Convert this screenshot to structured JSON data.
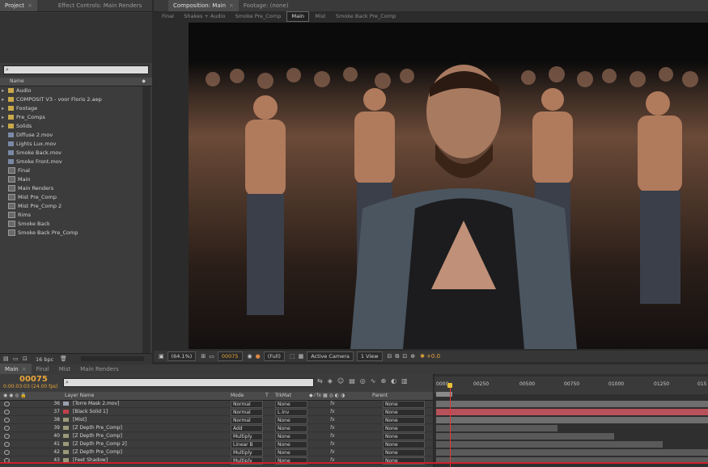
{
  "project_panel": {
    "tabs": [
      {
        "label": "Project"
      },
      {
        "label": "Effect Controls: Main Renders"
      }
    ],
    "header": {
      "name_col": "Name"
    },
    "items": [
      {
        "label": "Audio",
        "type": "folder",
        "label_color": "#d8cc5a"
      },
      {
        "label": "COMPOSIT V3 - voor Floris 2.aep",
        "type": "folder",
        "label_color": "#d8cc5a"
      },
      {
        "label": "Footage",
        "type": "folder",
        "label_color": "#d8cc5a"
      },
      {
        "label": "Pre_Comps",
        "type": "folder",
        "label_color": "#d8cc5a"
      },
      {
        "label": "Solids",
        "type": "folder",
        "label_color": "#d8cc5a"
      },
      {
        "label": "Diffuse 2.mov",
        "type": "footage",
        "label_color": "#9a9a9a"
      },
      {
        "label": "Lights Lux.mov",
        "type": "footage",
        "label_color": "#9a9a9a"
      },
      {
        "label": "Smoke Back.mov",
        "type": "footage",
        "label_color": "#9a9a9a"
      },
      {
        "label": "Smoke Front.mov",
        "type": "footage",
        "label_color": "#9a9a9a"
      },
      {
        "label": "Final",
        "type": "comp",
        "label_color": "#9a9a9a"
      },
      {
        "label": "Main",
        "type": "comp",
        "label_color": "#9a9a9a"
      },
      {
        "label": "Main Renders",
        "type": "comp",
        "label_color": "#9a9a9a"
      },
      {
        "label": "Mist Pre_Comp",
        "type": "comp",
        "label_color": "#9a9a9a"
      },
      {
        "label": "Mist Pre_Comp 2",
        "type": "comp",
        "label_color": "#9a9a9a"
      },
      {
        "label": "Rims",
        "type": "comp",
        "label_color": "#9a9a9a"
      },
      {
        "label": "Smoke Back",
        "type": "comp",
        "label_color": "#9a9a9a"
      },
      {
        "label": "Smoke Back Pre_Comp",
        "type": "comp",
        "label_color": "#9a9a9a"
      }
    ],
    "footer": {
      "bpc": "16 bpc"
    }
  },
  "comp_panel": {
    "tabs": [
      {
        "label": "Composition: Main"
      },
      {
        "label": "Footage: (none)"
      }
    ],
    "breadcrumbs": [
      {
        "label": "Final",
        "active": false
      },
      {
        "label": "Shakes + Audio",
        "active": false
      },
      {
        "label": "Smoke Pre_Comp",
        "active": false
      },
      {
        "label": "Main",
        "active": true
      },
      {
        "label": "Mist",
        "active": false
      },
      {
        "label": "Smoke Back Pre_Comp",
        "active": false
      }
    ],
    "footer": {
      "zoom": "(64.1%)",
      "timecode": "00075",
      "resolution": "(Full)",
      "camera": "Active Camera",
      "views": "1 View",
      "exposure": "+0.0"
    }
  },
  "timeline": {
    "tabs": [
      {
        "label": "Main",
        "active": true
      },
      {
        "label": "Final",
        "active": false
      },
      {
        "label": "Mist",
        "active": false
      },
      {
        "label": "Main Renders",
        "active": false
      }
    ],
    "timecode": "00075",
    "fps_readout": "0:00:03:03 (24.00 fps)",
    "columns": {
      "layer_name": "Layer Name",
      "mode": "Mode",
      "t": "T",
      "trkmat": "TrkMat",
      "parent": "Parent"
    },
    "ruler_ticks": [
      "0000",
      "00250",
      "00500",
      "00750",
      "01000",
      "01250",
      "015"
    ],
    "layers": [
      {
        "num": "36",
        "name": "[Torre Mask 2.mov]",
        "mode": "Normal",
        "trkmat": "None",
        "parent": "None",
        "label_color": "#9aa0b0"
      },
      {
        "num": "37",
        "name": "[Black Solid 1]",
        "mode": "Normal",
        "trkmat": "L.Inv",
        "parent": "None",
        "label_color": "#c0404a"
      },
      {
        "num": "38",
        "name": "[Mist]",
        "mode": "Normal",
        "trkmat": "None",
        "parent": "None",
        "label_color": "#9a9a7a"
      },
      {
        "num": "39",
        "name": "[Z Depth Pre_Comp]",
        "mode": "Add",
        "trkmat": "None",
        "parent": "None",
        "label_color": "#9a9a7a"
      },
      {
        "num": "40",
        "name": "[Z Depth Pre_Comp]",
        "mode": "Multiply",
        "trkmat": "None",
        "parent": "None",
        "label_color": "#9a9a7a"
      },
      {
        "num": "41",
        "name": "[Z Depth Pre_Comp 2]",
        "mode": "Linear B",
        "trkmat": "None",
        "parent": "None",
        "label_color": "#9a9a7a"
      },
      {
        "num": "42",
        "name": "[Z Depth Pre_Comp]",
        "mode": "Multiply",
        "trkmat": "None",
        "parent": "None",
        "label_color": "#9a9a7a"
      },
      {
        "num": "43",
        "name": "[Feet Shadow]",
        "mode": "Multiply",
        "trkmat": "None",
        "parent": "None",
        "label_color": "#9a9a7a"
      }
    ],
    "bar_color_red": "#b8525a",
    "bar_color_gray": "#6e6e6e"
  }
}
